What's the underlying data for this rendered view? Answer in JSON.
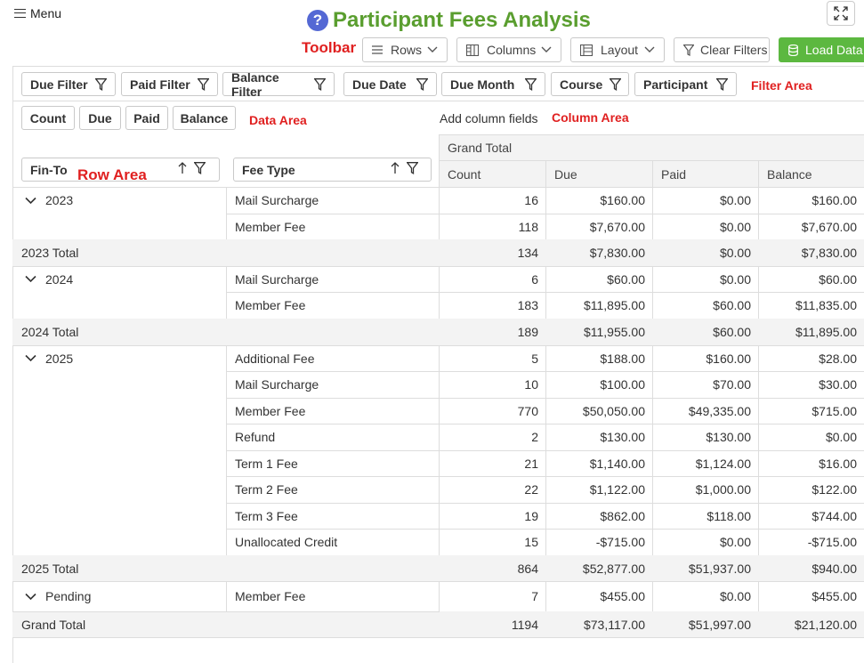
{
  "header": {
    "menu_label": "Menu",
    "title": "Participant Fees Analysis"
  },
  "toolbar": {
    "label": "Toolbar",
    "rows": "Rows",
    "columns": "Columns",
    "layout": "Layout",
    "clear_filters": "Clear Filters",
    "load_data": "Load Data"
  },
  "filters": {
    "items": [
      "Due Filter",
      "Paid Filter",
      "Balance Filter",
      "Due Date",
      "Due Month",
      "Course",
      "Participant"
    ],
    "area_label": "Filter Area"
  },
  "data_area": {
    "items": [
      "Count",
      "Due",
      "Paid",
      "Balance"
    ],
    "label": "Data Area"
  },
  "column_area": {
    "add_text": "Add column fields",
    "label": "Column Area",
    "grand_total": "Grand Total",
    "measures": [
      "Count",
      "Due",
      "Paid",
      "Balance"
    ]
  },
  "row_area": {
    "fields": [
      "Fin-To",
      "Fee Type"
    ],
    "label": "Row Area"
  },
  "rows": [
    {
      "group": "2023",
      "fee": "Mail Surcharge",
      "count": "16",
      "due": "$160.00",
      "paid": "$0.00",
      "balance": "$160.00"
    },
    {
      "group": "",
      "fee": "Member Fee",
      "count": "118",
      "due": "$7,670.00",
      "paid": "$0.00",
      "balance": "$7,670.00"
    },
    {
      "total": "2023 Total",
      "count": "134",
      "due": "$7,830.00",
      "paid": "$0.00",
      "balance": "$7,830.00"
    },
    {
      "group": "2024",
      "fee": "Mail Surcharge",
      "count": "6",
      "due": "$60.00",
      "paid": "$0.00",
      "balance": "$60.00"
    },
    {
      "group": "",
      "fee": "Member Fee",
      "count": "183",
      "due": "$11,895.00",
      "paid": "$60.00",
      "balance": "$11,835.00"
    },
    {
      "total": "2024 Total",
      "count": "189",
      "due": "$11,955.00",
      "paid": "$60.00",
      "balance": "$11,895.00"
    },
    {
      "group": "2025",
      "fee": "Additional Fee",
      "count": "5",
      "due": "$188.00",
      "paid": "$160.00",
      "balance": "$28.00"
    },
    {
      "group": "",
      "fee": "Mail Surcharge",
      "count": "10",
      "due": "$100.00",
      "paid": "$70.00",
      "balance": "$30.00"
    },
    {
      "group": "",
      "fee": "Member Fee",
      "count": "770",
      "due": "$50,050.00",
      "paid": "$49,335.00",
      "balance": "$715.00"
    },
    {
      "group": "",
      "fee": "Refund",
      "count": "2",
      "due": "$130.00",
      "paid": "$130.00",
      "balance": "$0.00"
    },
    {
      "group": "",
      "fee": "Term 1 Fee",
      "count": "21",
      "due": "$1,140.00",
      "paid": "$1,124.00",
      "balance": "$16.00"
    },
    {
      "group": "",
      "fee": "Term 2 Fee",
      "count": "22",
      "due": "$1,122.00",
      "paid": "$1,000.00",
      "balance": "$122.00"
    },
    {
      "group": "",
      "fee": "Term 3 Fee",
      "count": "19",
      "due": "$862.00",
      "paid": "$118.00",
      "balance": "$744.00"
    },
    {
      "group": "",
      "fee": "Unallocated Credit",
      "count": "15",
      "due": "-$715.00",
      "paid": "$0.00",
      "balance": "-$715.00"
    },
    {
      "total": "2025 Total",
      "count": "864",
      "due": "$52,877.00",
      "paid": "$51,937.00",
      "balance": "$940.00"
    },
    {
      "group": "Pending",
      "fee": "Member Fee",
      "count": "7",
      "due": "$455.00",
      "paid": "$0.00",
      "balance": "$455.00"
    },
    {
      "total": "Grand Total",
      "count": "1194",
      "due": "$73,117.00",
      "paid": "$51,997.00",
      "balance": "$21,120.00"
    }
  ]
}
